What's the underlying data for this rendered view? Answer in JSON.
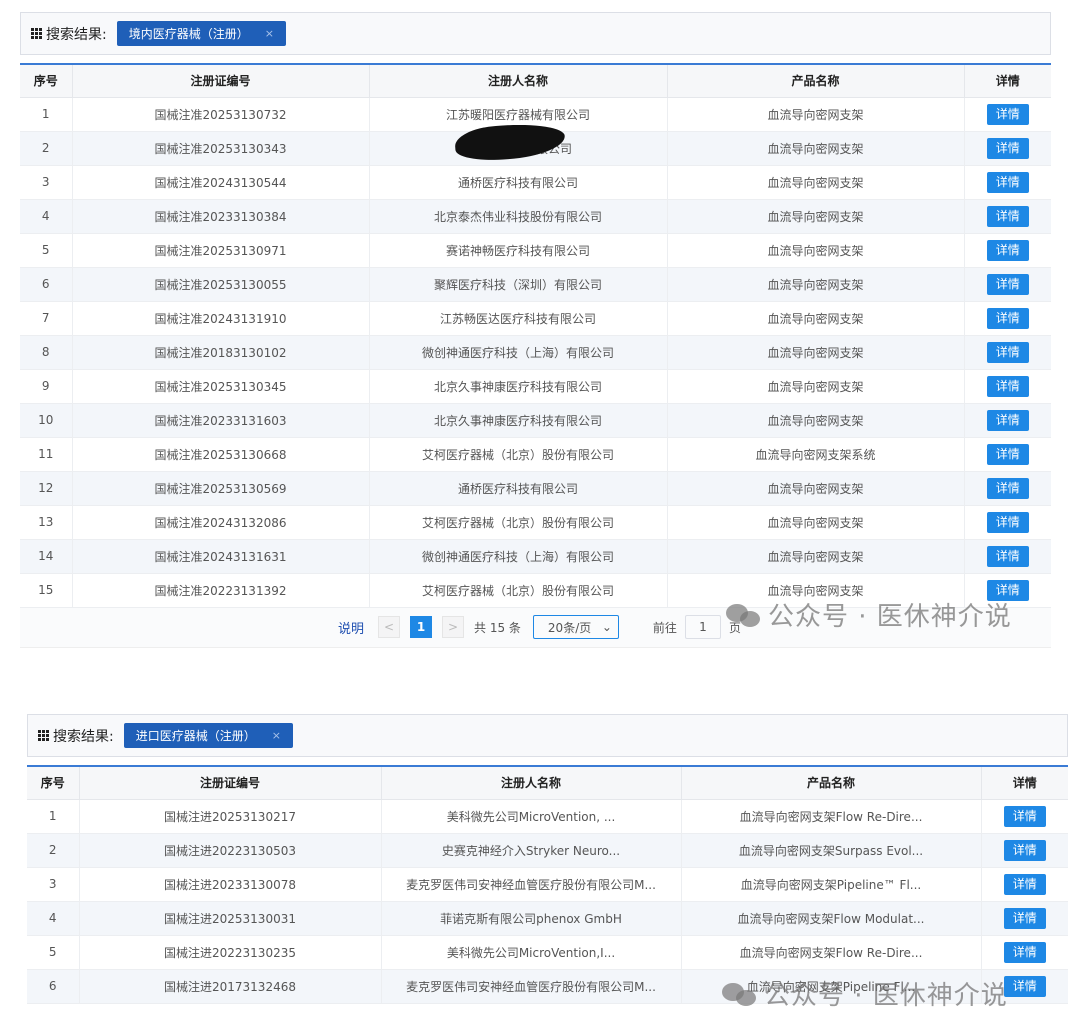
{
  "domestic": {
    "search_label": "搜索结果:",
    "tag": "境内医疗器械（注册）",
    "tag_close": "×",
    "headers": [
      "序号",
      "注册证编号",
      "注册人名称",
      "产品名称",
      "详情"
    ],
    "rows": [
      [
        "1",
        "国械注准20253130732",
        "江苏暖阳医疗器械有限公司",
        "血流导向密网支架",
        "详情"
      ],
      [
        "2",
        "国械注准20253130343",
        "上…………有限公司",
        "血流导向密网支架",
        "详情"
      ],
      [
        "3",
        "国械注准20243130544",
        "通桥医疗科技有限公司",
        "血流导向密网支架",
        "详情"
      ],
      [
        "4",
        "国械注准20233130384",
        "北京泰杰伟业科技股份有限公司",
        "血流导向密网支架",
        "详情"
      ],
      [
        "5",
        "国械注准20253130971",
        "赛诺神畅医疗科技有限公司",
        "血流导向密网支架",
        "详情"
      ],
      [
        "6",
        "国械注准20253130055",
        "聚辉医疗科技（深圳）有限公司",
        "血流导向密网支架",
        "详情"
      ],
      [
        "7",
        "国械注准20243131910",
        "江苏畅医达医疗科技有限公司",
        "血流导向密网支架",
        "详情"
      ],
      [
        "8",
        "国械注准20183130102",
        "微创神通医疗科技（上海）有限公司",
        "血流导向密网支架",
        "详情"
      ],
      [
        "9",
        "国械注准20253130345",
        "北京久事神康医疗科技有限公司",
        "血流导向密网支架",
        "详情"
      ],
      [
        "10",
        "国械注准20233131603",
        "北京久事神康医疗科技有限公司",
        "血流导向密网支架",
        "详情"
      ],
      [
        "11",
        "国械注准20253130668",
        "艾柯医疗器械（北京）股份有限公司",
        "血流导向密网支架系统",
        "详情"
      ],
      [
        "12",
        "国械注准20253130569",
        "通桥医疗科技有限公司",
        "血流导向密网支架",
        "详情"
      ],
      [
        "13",
        "国械注准20243132086",
        "艾柯医疗器械（北京）股份有限公司",
        "血流导向密网支架",
        "详情"
      ],
      [
        "14",
        "国械注准20243131631",
        "微创神通医疗科技（上海）有限公司",
        "血流导向密网支架",
        "详情"
      ],
      [
        "15",
        "国械注准20223131392",
        "艾柯医疗器械（北京）股份有限公司",
        "血流导向密网支架",
        "详情"
      ]
    ],
    "pager": {
      "note": "说明",
      "prev": "<",
      "current": "1",
      "next": ">",
      "total": "共 15 条",
      "page_size": "20条/页",
      "page_size_arrow": "⌄",
      "goto": "前往",
      "goto_value": "1",
      "page_unit": "页"
    },
    "watermark": "公众号 · 医休神介说"
  },
  "imported": {
    "search_label": "搜索结果:",
    "tag": "进口医疗器械（注册）",
    "tag_close": "×",
    "headers": [
      "序号",
      "注册证编号",
      "注册人名称",
      "产品名称",
      "详情"
    ],
    "rows": [
      [
        "1",
        "国械注进20253130217",
        "美科微先公司MicroVention, ...",
        "血流导向密网支架Flow Re-Dire...",
        "详情"
      ],
      [
        "2",
        "国械注进20223130503",
        "史赛克神经介入Stryker Neuro...",
        "血流导向密网支架Surpass Evol...",
        "详情"
      ],
      [
        "3",
        "国械注进20233130078",
        "麦克罗医伟司安神经血管医疗股份有限公司M...",
        "血流导向密网支架Pipeline™ Fl...",
        "详情"
      ],
      [
        "4",
        "国械注进20253130031",
        "菲诺克斯有限公司phenox GmbH",
        "血流导向密网支架Flow Modulat...",
        "详情"
      ],
      [
        "5",
        "国械注进20223130235",
        "美科微先公司MicroVention,I...",
        "血流导向密网支架Flow Re-Dire...",
        "详情"
      ],
      [
        "6",
        "国械注进20173132468",
        "麦克罗医伟司安神经血管医疗股份有限公司M...",
        "血流导向密网支架Pipeline Fl...",
        "详情"
      ]
    ],
    "watermark": "公众号 · 医休神介说"
  }
}
